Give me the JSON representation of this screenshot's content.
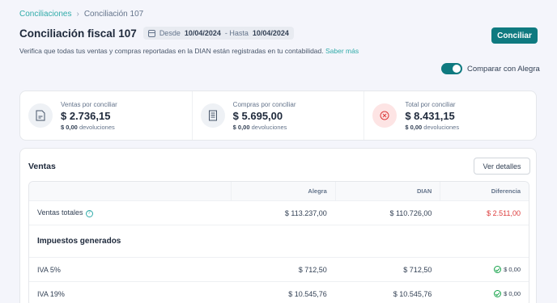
{
  "breadcrumb": {
    "parent": "Conciliaciones",
    "separator": "›",
    "current": "Conciliación 107"
  },
  "header": {
    "title": "Conciliación fiscal 107",
    "date_from_label": "Desde",
    "date_from": "10/04/2024",
    "date_sep": "- Hasta",
    "date_to": "10/04/2024",
    "primary_button": "Conciliar",
    "subtitle": "Verifica que todas tus ventas y compras reportadas en la DIAN están registradas en tu contabilidad.",
    "learn_more": "Saber más"
  },
  "toggle": {
    "label": "Comparar con Alegra",
    "on": true
  },
  "summary": [
    {
      "label": "Ventas por conciliar",
      "value": "$ 2.736,15",
      "sub_value": "$ 0,00",
      "sub_label": "devoluciones",
      "icon": "document-icon"
    },
    {
      "label": "Compras por conciliar",
      "value": "$ 5.695,00",
      "sub_value": "$ 0,00",
      "sub_label": "devoluciones",
      "icon": "receipt-icon"
    },
    {
      "label": "Total por conciliar",
      "value": "$ 8.431,15",
      "sub_value": "$ 0,00",
      "sub_label": "devoluciones",
      "icon": "close-circle-icon"
    }
  ],
  "ventas": {
    "title": "Ventas",
    "details_button": "Ver detalles",
    "columns": [
      "",
      "Alegra",
      "DIAN",
      "Diferencia"
    ],
    "total_row": {
      "label": "Ventas totales",
      "alegra": "$ 113.237,00",
      "dian": "$ 110.726,00",
      "diff": "$ 2.511,00"
    },
    "section_title": "Impuestos generados",
    "tax_rows": [
      {
        "label": "IVA 5%",
        "alegra": "$ 712,50",
        "dian": "$ 712,50",
        "diff": "$ 0,00"
      },
      {
        "label": "IVA 19%",
        "alegra": "$ 10.545,76",
        "dian": "$ 10.545,76",
        "diff": "$ 0,00"
      }
    ]
  },
  "colors": {
    "accent": "#0f7a80",
    "link": "#30aba9",
    "negative": "#dc3b3b",
    "ok": "#16a34a"
  }
}
